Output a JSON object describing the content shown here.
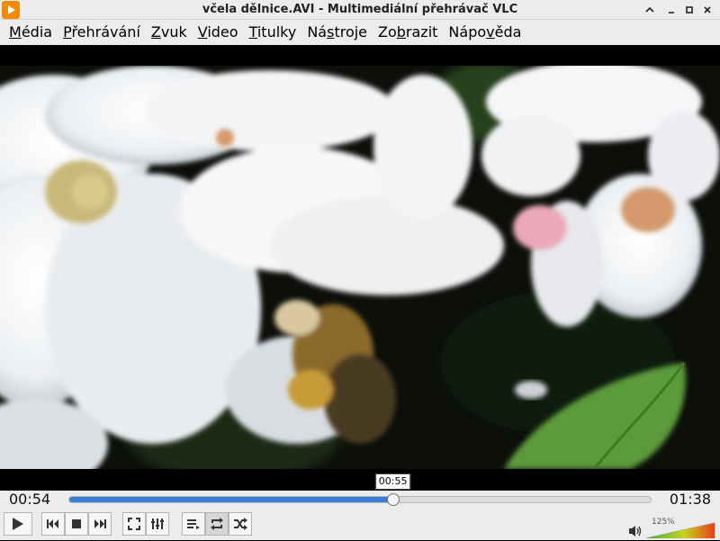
{
  "window": {
    "title": "včela dělnice.AVI - Multimediální přehrávač VLC",
    "icon": "vlc-cone-icon"
  },
  "menu": [
    {
      "pre": "",
      "u": "M",
      "post": "édia"
    },
    {
      "pre": "",
      "u": "P",
      "post": "řehrávání"
    },
    {
      "pre": "",
      "u": "Z",
      "post": "vuk"
    },
    {
      "pre": "",
      "u": "V",
      "post": "ideo"
    },
    {
      "pre": "",
      "u": "T",
      "post": "itulky"
    },
    {
      "pre": "Ná",
      "u": "s",
      "post": "troje"
    },
    {
      "pre": "Zo",
      "u": "b",
      "post": "razit"
    },
    {
      "pre": "Nápo",
      "u": "v",
      "post": "ěda"
    }
  ],
  "playback": {
    "elapsed": "00:54",
    "total": "01:38",
    "hover_time": "00:55",
    "progress": 0.555
  },
  "volume": {
    "percent_label": "125%",
    "level": 1.0
  },
  "colors": {
    "seek_fill": "#3a7ed6",
    "volume_low": "#3cb043",
    "volume_high": "#e8421c",
    "titlebar_bg": "#ececec"
  },
  "video": {
    "description_icon": "bee-on-apple-blossom-frame"
  }
}
